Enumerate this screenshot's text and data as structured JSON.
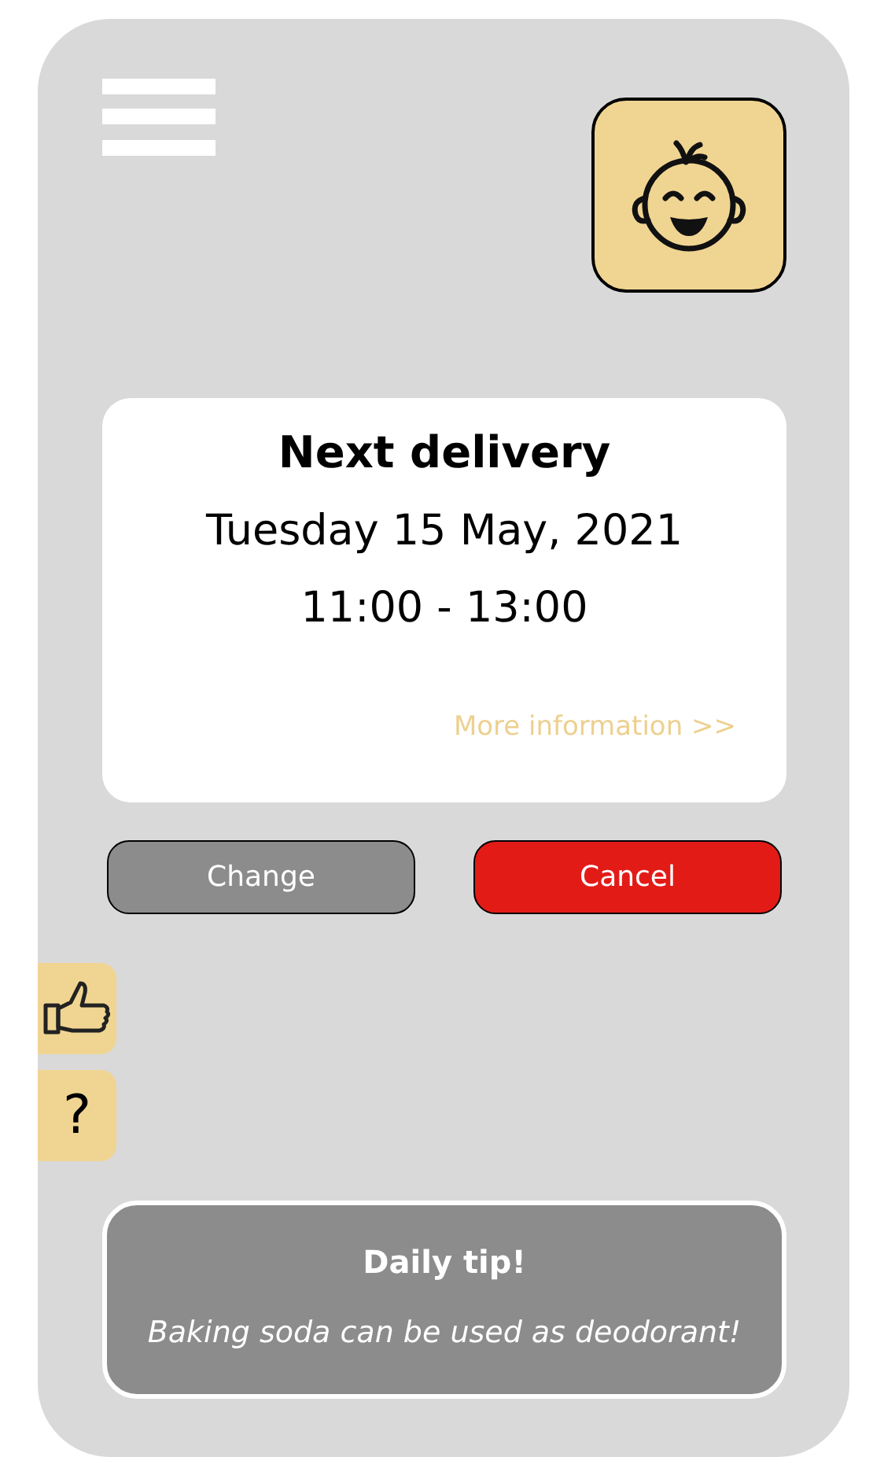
{
  "delivery": {
    "title": "Next delivery",
    "date": "Tuesday 15 May, 2021",
    "time": "11:00 - 13:00",
    "link": "More information >>"
  },
  "buttons": [
    {
      "label": "Change",
      "kind": "secondary"
    },
    {
      "label": "Cancel",
      "kind": "danger"
    }
  ],
  "side_tabs": [
    {
      "kind": "icon"
    },
    {
      "kind": "text",
      "label": "?"
    }
  ],
  "tip": {
    "title": "Daily tip!",
    "text": "Baking soda can be used as deodorant!"
  }
}
